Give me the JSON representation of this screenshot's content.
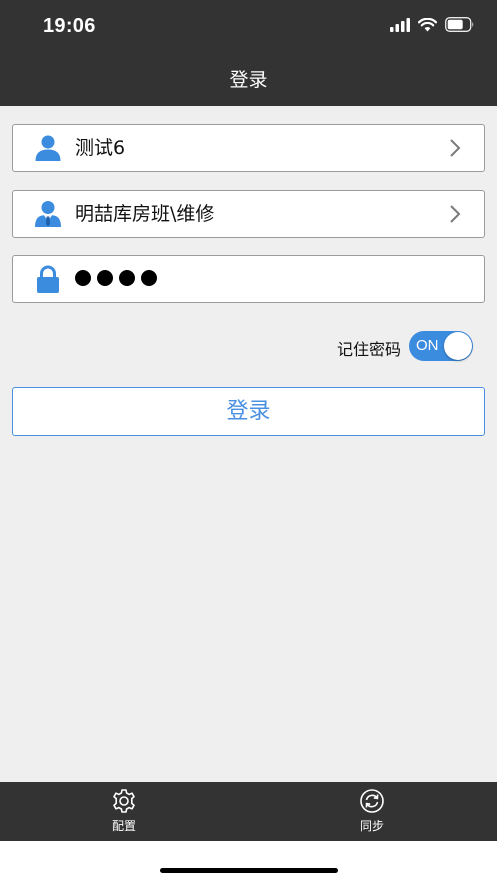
{
  "status_bar": {
    "time": "19:06"
  },
  "nav": {
    "title": "登录"
  },
  "form": {
    "user": {
      "value": "测试6",
      "icon": "user-icon"
    },
    "department": {
      "value": "明喆库房班\\维修",
      "icon": "staff-icon"
    },
    "password": {
      "masked_length": 4,
      "icon": "lock-icon"
    },
    "remember": {
      "label": "记住密码",
      "toggle_text": "ON",
      "on": true
    },
    "login_label": "登录"
  },
  "tab_bar": {
    "items": [
      {
        "label": "配置",
        "icon": "gear-icon"
      },
      {
        "label": "同步",
        "icon": "sync-icon"
      }
    ]
  },
  "colors": {
    "bar": "#333333",
    "accent": "#4a90e2",
    "icon_blue": "#3b8bdf",
    "background": "#efefef"
  }
}
